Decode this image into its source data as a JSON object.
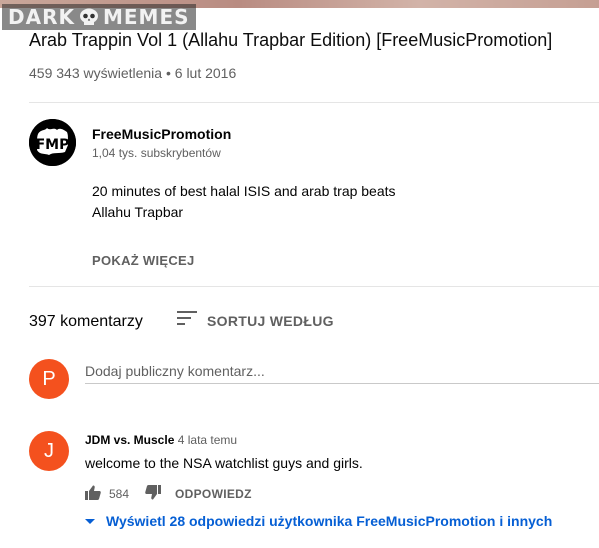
{
  "watermark": {
    "left": "DARK",
    "right": "MEMES"
  },
  "video": {
    "title": "Arab Trappin Vol 1 (Allahu Trapbar Edition) [FreeMusicPromotion]",
    "meta": "459 343 wyświetlenia • 6 lut 2016"
  },
  "channel": {
    "name": "FreeMusicPromotion",
    "subscribers": "1,04 tys. subskrybentów",
    "avatar_text": "FMP",
    "description_lines": [
      "20 minutes of best halal ISIS and arab trap beats",
      "Allahu Trapbar"
    ],
    "show_more_label": "POKAŻ WIĘCEJ"
  },
  "comments_header": {
    "count": "397 komentarzy",
    "sort_label": "SORTUJ WEDŁUG",
    "sort_icon": "sort-icon"
  },
  "add_comment": {
    "avatar_letter": "P",
    "avatar_color": "#f4511e",
    "placeholder": "Dodaj publiczny komentarz..."
  },
  "comments": [
    {
      "avatar_letter": "J",
      "avatar_color": "#f4511e",
      "author": "JDM vs. Muscle",
      "time": "4 lata temu",
      "text": "welcome to the NSA watchlist guys and girls.",
      "likes": "584",
      "reply_label": "ODPOWIEDZ",
      "view_replies_label": "Wyświetl 28 odpowiedzi użytkownika FreeMusicPromotion i innych"
    }
  ],
  "colors": {
    "link": "#065fd4",
    "secondary_text": "#606060",
    "avatar_orange": "#f4511e"
  }
}
